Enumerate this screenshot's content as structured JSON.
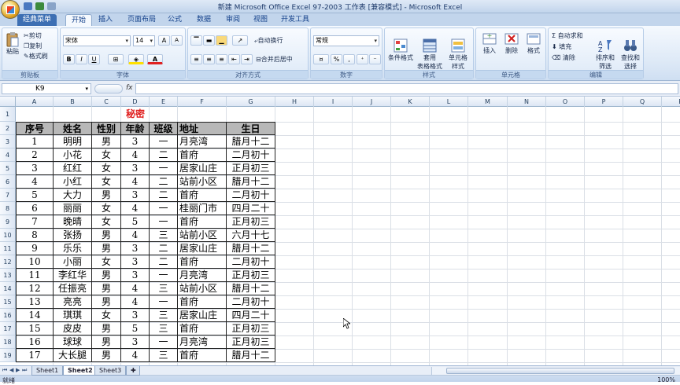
{
  "window": {
    "title": "新建 Microsoft Office Excel 97-2003 工作表 [兼容模式] - Microsoft Excel"
  },
  "tabs": [
    "经典菜单",
    "开始",
    "插入",
    "页面布局",
    "公式",
    "数据",
    "审阅",
    "视图",
    "开发工具"
  ],
  "ribbon": {
    "clipboard": {
      "paste": "粘贴",
      "cut": "剪切",
      "copy": "复制",
      "format_painter": "格式刷",
      "label": "剪贴板"
    },
    "font": {
      "name": "宋体",
      "size": "14",
      "bold": "B",
      "italic": "I",
      "underline": "U",
      "label": "字体"
    },
    "alignment": {
      "wrap": "自动换行",
      "merge": "合并后居中",
      "label": "对齐方式"
    },
    "number": {
      "format": "常规",
      "percent": "%",
      "comma": ",",
      "label": "数字"
    },
    "styles": {
      "conditional": "条件格式",
      "table": "套用\n表格格式",
      "cell": "单元格\n样式",
      "label": "样式"
    },
    "cells": {
      "insert": "插入",
      "delete": "删除",
      "format": "格式",
      "label": "单元格"
    },
    "editing": {
      "autosum": "自动求和",
      "fill": "填充",
      "clear": "清除",
      "sort": "排序和\n筛选",
      "find": "查找和\n选择",
      "label": "编辑"
    }
  },
  "formula_bar": {
    "name_box": "K9",
    "fx": "fx",
    "value": ""
  },
  "columns": [
    "A",
    "B",
    "C",
    "D",
    "E",
    "F",
    "G",
    "H",
    "I",
    "J",
    "K",
    "L",
    "M",
    "N",
    "O",
    "P",
    "Q",
    "R"
  ],
  "rows": [
    "1",
    "2",
    "3",
    "4",
    "5",
    "6",
    "7",
    "8",
    "9",
    "10",
    "11",
    "12",
    "13",
    "14",
    "15",
    "16",
    "17",
    "18",
    "19"
  ],
  "sheet": {
    "title": "秘密",
    "headers": [
      "序号",
      "姓名",
      "性别",
      "年龄",
      "班级",
      "地址",
      "生日"
    ],
    "data": [
      [
        "1",
        "明明",
        "男",
        "3",
        "一",
        "月亮湾",
        "腊月十二"
      ],
      [
        "2",
        "小花",
        "女",
        "4",
        "二",
        "首府",
        "二月初十"
      ],
      [
        "3",
        "红红",
        "女",
        "3",
        "一",
        "居家山庄",
        "正月初三"
      ],
      [
        "4",
        "小红",
        "女",
        "4",
        "二",
        "站前小区",
        "腊月十二"
      ],
      [
        "5",
        "大力",
        "男",
        "3",
        "二",
        "首府",
        "二月初十"
      ],
      [
        "6",
        "丽丽",
        "女",
        "4",
        "一",
        "桂丽门市",
        "四月二十"
      ],
      [
        "7",
        "晚晴",
        "女",
        "5",
        "一",
        "首府",
        "正月初三"
      ],
      [
        "8",
        "张扬",
        "男",
        "4",
        "三",
        "站前小区",
        "六月十七"
      ],
      [
        "9",
        "乐乐",
        "男",
        "3",
        "二",
        "居家山庄",
        "腊月十二"
      ],
      [
        "10",
        "小丽",
        "女",
        "3",
        "二",
        "首府",
        "二月初十"
      ],
      [
        "11",
        "李红华",
        "男",
        "3",
        "一",
        "月亮湾",
        "正月初三"
      ],
      [
        "12",
        "任振亮",
        "男",
        "4",
        "三",
        "站前小区",
        "腊月十二"
      ],
      [
        "13",
        "亮亮",
        "男",
        "4",
        "一",
        "首府",
        "二月初十"
      ],
      [
        "14",
        "琪琪",
        "女",
        "3",
        "三",
        "居家山庄",
        "四月二十"
      ],
      [
        "15",
        "皮皮",
        "男",
        "5",
        "三",
        "首府",
        "正月初三"
      ],
      [
        "16",
        "球球",
        "男",
        "3",
        "一",
        "月亮湾",
        "正月初三"
      ],
      [
        "17",
        "大长腿",
        "男",
        "4",
        "三",
        "首府",
        "腊月十二"
      ]
    ]
  },
  "sheets": [
    "Sheet1",
    "Sheet2",
    "Sheet3"
  ],
  "status": {
    "text": "就绪",
    "zoom": "100%"
  }
}
